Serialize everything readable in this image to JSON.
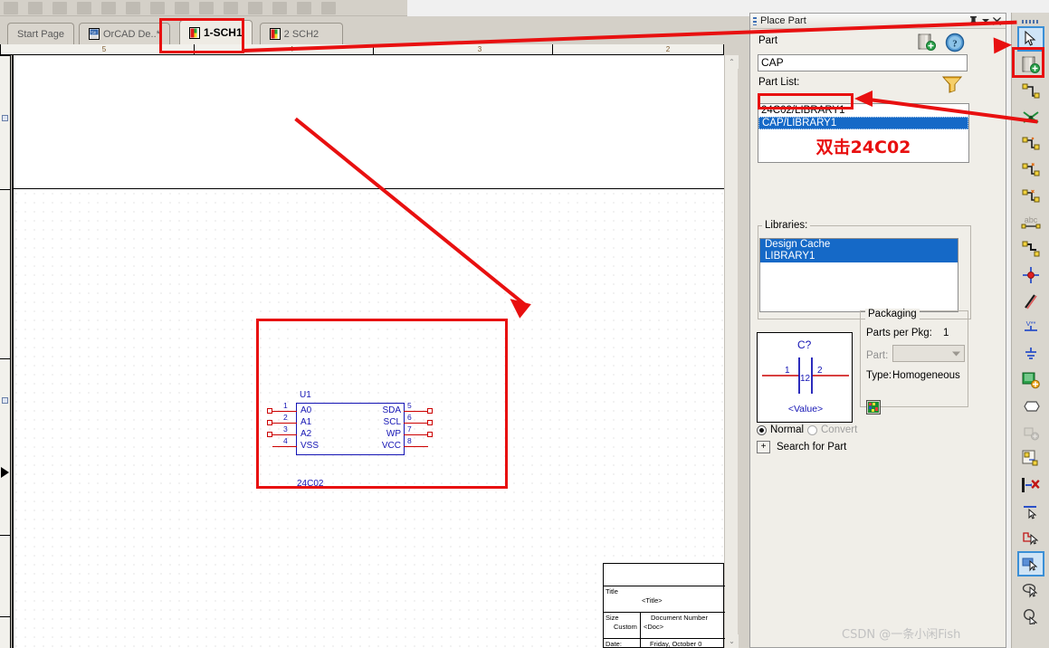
{
  "window": {
    "toolbar_placeholder_count": 14
  },
  "tabs": [
    {
      "label": "Start Page",
      "icon": null,
      "active": false,
      "highlighted": false
    },
    {
      "label": "OrCAD De..*",
      "icon": "schematic-icon",
      "active": false,
      "highlighted": false
    },
    {
      "label": "1-SCH1",
      "icon": "page-icon",
      "active": true,
      "highlighted": true
    },
    {
      "label": "2 SCH2",
      "icon": "page-icon",
      "active": false,
      "highlighted": false
    }
  ],
  "canvas": {
    "hruler_ticks": [
      "5",
      "4",
      "3",
      "2"
    ],
    "scroll_up": "⌃",
    "scroll_down": "⌄"
  },
  "schematic": {
    "reference_designator": "U1",
    "part_value": "24C02",
    "left_pins": [
      {
        "num": "1",
        "name": "A0"
      },
      {
        "num": "2",
        "name": "A1"
      },
      {
        "num": "3",
        "name": "A2"
      },
      {
        "num": "4",
        "name": "VSS"
      }
    ],
    "right_pins": [
      {
        "num": "5",
        "name": "SDA"
      },
      {
        "num": "6",
        "name": "SCL"
      },
      {
        "num": "7",
        "name": "WP"
      },
      {
        "num": "8",
        "name": "VCC"
      }
    ]
  },
  "title_block": {
    "title_label": "Title",
    "title_value": "<Title>",
    "size_label": "Size",
    "size_value": "Custom",
    "doc_label": "Document  Number",
    "doc_value": "<Doc>",
    "date_label": "Date:",
    "date_value": "Friday, October 0"
  },
  "place_part": {
    "title": "Place Part",
    "pin_btn": "▬",
    "menu_btn": "▾",
    "close_btn": "✖",
    "part_label": "Part",
    "part_value": "CAP",
    "part_list_label": "Part List:",
    "part_list": [
      {
        "text": "24C02/LIBRARY1",
        "selected": false,
        "boxed": true
      },
      {
        "text": "CAP/LIBRARY1",
        "selected": true,
        "boxed": false
      }
    ],
    "chinese_note": "双击24C02",
    "libraries_label": "Libraries:",
    "libraries": [
      {
        "text": "Design Cache",
        "selected": true
      },
      {
        "text": "LIBRARY1",
        "selected": true
      }
    ],
    "add_library_icon": "add-library-icon",
    "remove_library_icon": "remove-library-icon",
    "new_part_icon": "new-part-icon",
    "help_icon": "help-icon",
    "filter_icon": "filter-funnel-icon",
    "preview": {
      "refdes": "C?",
      "pin_left": "1",
      "pin_right": "2",
      "pin_center": "12",
      "value": "<Value>"
    },
    "packaging": {
      "group_label": "Packaging",
      "parts_per_pkg_label": "Parts per Pkg:",
      "parts_per_pkg_value": "1",
      "part_label": "Part:",
      "part_value": "",
      "type_label": "Type:",
      "type_value": "Homogeneous",
      "pinout_icon": "pinout-icon"
    },
    "normal_label": "Normal",
    "convert_label": "Convert",
    "normal_selected": true,
    "convert_selected": false,
    "search_expand": "+",
    "search_label": "Search for Part"
  },
  "right_toolbar": [
    {
      "name": "select-tool",
      "selected": true
    },
    {
      "name": "place-part-tool",
      "selected": false,
      "highlighted": true
    },
    {
      "name": "place-wire-tool",
      "selected": false
    },
    {
      "name": "place-net-alias-tool",
      "selected": false
    },
    {
      "name": "place-bus-tool",
      "selected": false
    },
    {
      "name": "place-junction-tool",
      "selected": false
    },
    {
      "name": "place-bus-entry-tool",
      "selected": false
    },
    {
      "name": "place-text-tool",
      "selected": false
    },
    {
      "name": "place-line-tool",
      "selected": false
    },
    {
      "name": "place-no-connect-tool",
      "selected": false
    },
    {
      "name": "place-polyline-tool",
      "selected": false
    },
    {
      "name": "place-power-tool",
      "selected": false
    },
    {
      "name": "place-ground-tool",
      "selected": false
    },
    {
      "name": "place-hier-block-tool",
      "selected": false
    },
    {
      "name": "place-port-tool",
      "selected": false
    },
    {
      "name": "place-pin-tool",
      "selected": false
    },
    {
      "name": "place-page-conn-tool",
      "selected": false
    },
    {
      "name": "delete-tool",
      "selected": false
    },
    {
      "name": "select-line-tool",
      "selected": false
    },
    {
      "name": "select-poly-tool",
      "selected": false
    },
    {
      "name": "select-rect-tool",
      "selected": true
    },
    {
      "name": "select-ellipse-tool",
      "selected": false
    },
    {
      "name": "zoom-tool",
      "selected": false
    }
  ],
  "watermark": "CSDN @一条小闲Fish",
  "colors": {
    "accent_red": "#e81010",
    "schematic_blue": "#1414b4",
    "wire_red": "#cc0000",
    "selection_blue": "#1569c7",
    "panel_bg": "#f0eee8",
    "chrome_bg": "#d4d0c8"
  }
}
